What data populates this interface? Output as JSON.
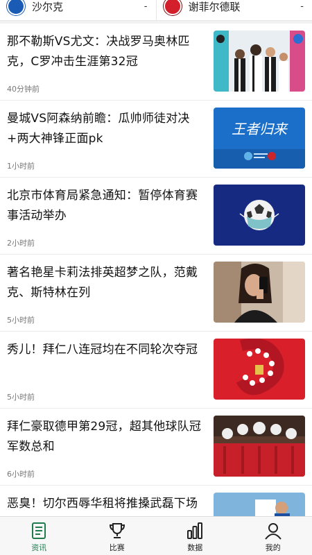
{
  "match": {
    "home": {
      "name": "沙尔克",
      "score": "-",
      "logo": "schalke-logo"
    },
    "away": {
      "name": "谢菲尔德联",
      "score": "-",
      "logo": "sheffield-united-logo"
    }
  },
  "news": [
    {
      "title": "那不勒斯VS尤文：决战罗马奥林匹克，C罗冲击生涯第32冠",
      "time": "40分钟前",
      "image": "juventus-players-photo"
    },
    {
      "title": "曼城VS阿森纳前瞻：瓜帅师徒对决+两大神锋正面pk",
      "time": "1小时前",
      "image": "王者归来 poster"
    },
    {
      "title": "北京市体育局紧急通知：暂停体育赛事活动举办",
      "time": "2小时前",
      "image": "football-with-mask"
    },
    {
      "title": "著名艳星卡莉法排英超梦之队，范戴克、斯特林在列",
      "time": "5小时前",
      "image": "selfie-photo"
    },
    {
      "title": "秀儿！拜仁八连冠均在不同轮次夺冠",
      "time": "5小时前",
      "image": "bayern-celebration"
    },
    {
      "title": "拜仁豪取德甲第29冠，超其他球队冠军数总和",
      "time": "6小时前",
      "image": "bayern-trophy-team"
    },
    {
      "title": "恶臭！切尔西辱华租将推搡武磊下场",
      "time": "",
      "image": "match-action-photo"
    }
  ],
  "thumb_texts": {
    "poster_title": "王者归来"
  },
  "tabs": [
    {
      "label": "资讯",
      "icon": "news-doc-icon",
      "active": true
    },
    {
      "label": "比赛",
      "icon": "trophy-icon",
      "active": false
    },
    {
      "label": "数据",
      "icon": "bar-chart-icon",
      "active": false
    },
    {
      "label": "我的",
      "icon": "user-icon",
      "active": false
    }
  ],
  "colors": {
    "accent": "#1f7a4d",
    "schalke": "#1a5bb5",
    "sheffield": "#d21f2b"
  }
}
